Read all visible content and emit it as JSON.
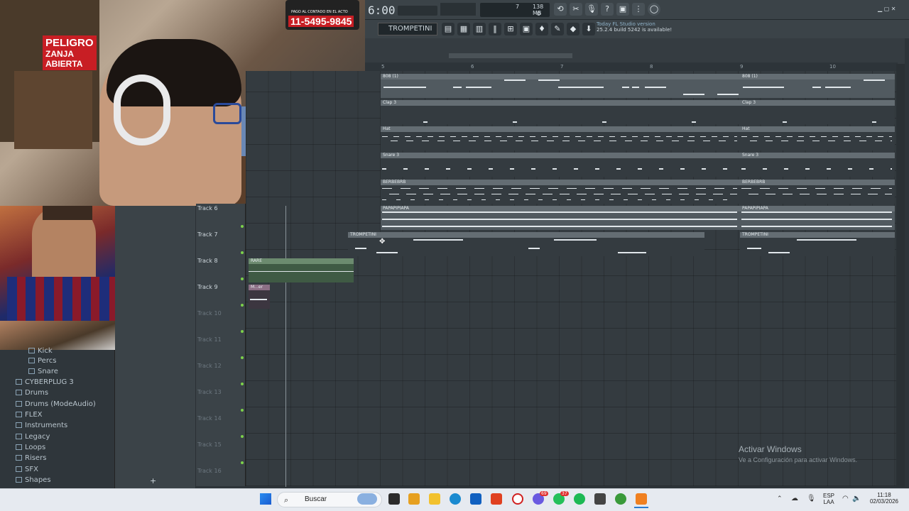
{
  "webcam": {
    "sign_text": "PELIGRO",
    "sign_text2": "ZANJA",
    "sign_text3": "ABIERTA",
    "ad_phone": "11-5495-9845",
    "ad_top": "PAGO AL CONTADO EN EL ACTO"
  },
  "header": {
    "time": "6:00",
    "cpu_value": "7",
    "mem_value": "138 MB",
    "poly_value": "0",
    "pattern": "TROMPETINI",
    "news_line1": "Today  FL Studio version",
    "news_line2": "25.2.4 build 5242 is available!"
  },
  "browser": {
    "items": [
      {
        "label": "Kick",
        "indent": true
      },
      {
        "label": "Percs",
        "indent": true
      },
      {
        "label": "Snare",
        "indent": true
      },
      {
        "label": "CYBERPLUG 3"
      },
      {
        "label": "Drums"
      },
      {
        "label": "Drums (ModeAudio)"
      },
      {
        "label": "FLEX"
      },
      {
        "label": "Instruments"
      },
      {
        "label": "Legacy"
      },
      {
        "label": "Loops"
      },
      {
        "label": "Risers"
      },
      {
        "label": "SFX"
      },
      {
        "label": "Shapes"
      }
    ],
    "add_label": "+"
  },
  "timeline": {
    "bars": [
      "5",
      "6",
      "7",
      "8",
      "9",
      "10"
    ]
  },
  "tracks": [
    "Track 6",
    "Track 7",
    "Track 8",
    "Track 9",
    "Track 10",
    "Track 11",
    "Track 12",
    "Track 13",
    "Track 14",
    "Track 15",
    "Track 16"
  ],
  "clips": {
    "c1": "808 (1)",
    "c1b": "808 (1)",
    "c2": "Clap 3",
    "c2b": "Clap 3",
    "c3": "Hat",
    "c3b": "Hat",
    "c4": "Snare 3",
    "c4b": "Snare 3",
    "c5": "BERBEBRB",
    "c5b": "BERBEBRB",
    "c6": "PAPAPIPIAPA",
    "c6b": "PAPAPIPIAPA",
    "c7": "TROMPETINI",
    "c7b": "TROMPETINI",
    "c8": "RARE",
    "c9": "M...er"
  },
  "watermark": {
    "title": "Activar Windows",
    "sub": "Ve a Configuración para activar Windows."
  },
  "taskbar": {
    "search": "Buscar",
    "lang1": "ESP",
    "lang2": "LAA",
    "clock": "11:18",
    "date": "02/03/2026",
    "badge1": "69",
    "badge2": "37"
  }
}
